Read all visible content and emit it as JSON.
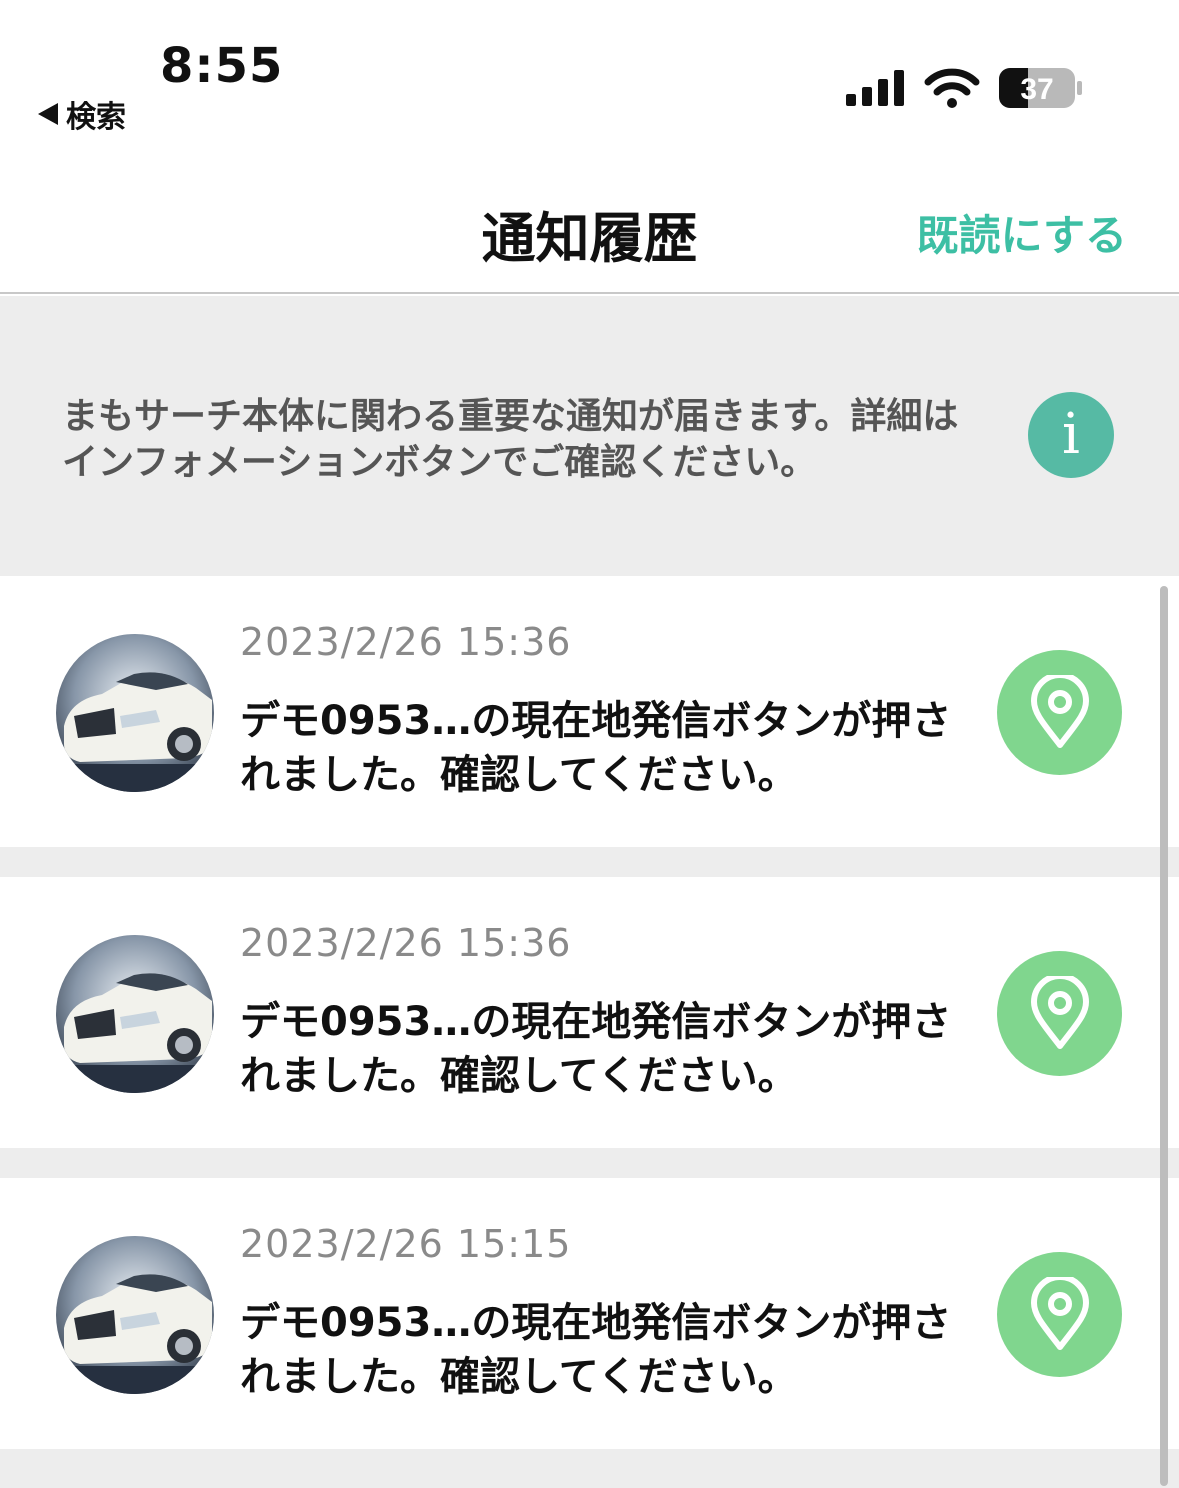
{
  "status_bar": {
    "time": "8:55",
    "back_label": "検索",
    "battery_level": "37"
  },
  "nav": {
    "title": "通知履歴",
    "mark_read_label": "既読にする"
  },
  "info_banner": {
    "text": "まもサーチ本体に関わる重要な通知が届きます。詳細はインフォメーションボタンでご確認ください。",
    "button_glyph": "i"
  },
  "notifications": [
    {
      "timestamp": "2023/2/26 15:36",
      "message": "デモ0953…の現在地発信ボタンが押されました。確認してください。",
      "icon": "location-pin-icon"
    },
    {
      "timestamp": "2023/2/26 15:36",
      "message": "デモ0953…の現在地発信ボタンが押されました。確認してください。",
      "icon": "location-pin-icon"
    },
    {
      "timestamp": "2023/2/26 15:15",
      "message": "デモ0953…の現在地発信ボタンが押されました。確認してください。",
      "icon": "location-pin-icon"
    }
  ],
  "colors": {
    "accent": "#3dbfa4",
    "info_button": "#56baa4",
    "pin_button": "#80d68e",
    "banner_bg": "#ededed"
  }
}
